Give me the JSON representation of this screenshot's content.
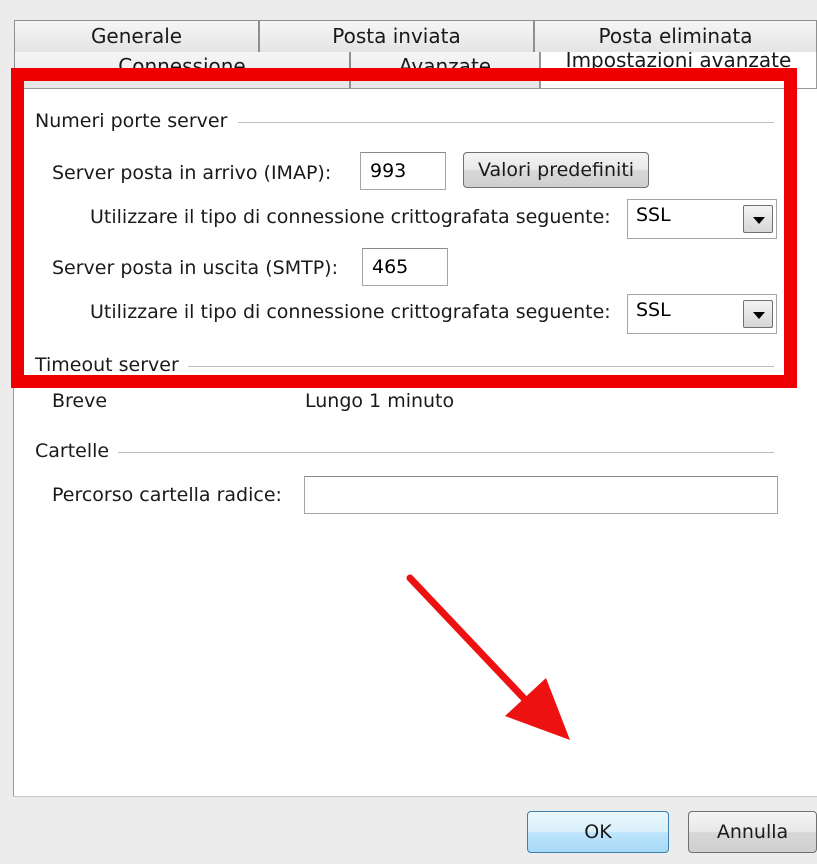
{
  "tabs_row1": [
    "Generale",
    "Posta inviata",
    "Posta eliminata"
  ],
  "tabs_row2": [
    "Connessione",
    "Avanzate",
    "Impostazioni avanzate"
  ],
  "ports": {
    "section_title": "Numeri porte server",
    "incoming_label": "Server posta in arrivo (IMAP):",
    "incoming_value": "993",
    "defaults_button": "Valori predefiniti",
    "encryption_label": "Utilizzare il tipo di connessione crittografata seguente:",
    "incoming_encryption": "SSL",
    "outgoing_label": "Server posta in uscita (SMTP):",
    "outgoing_value": "465",
    "outgoing_encryption": "SSL"
  },
  "timeout": {
    "section_title": "Timeout server",
    "short_label": "Breve",
    "long_label": "Lungo 1 minuto"
  },
  "folders": {
    "section_title": "Cartelle",
    "root_path_label": "Percorso cartella radice:",
    "root_path_value": ""
  },
  "footer": {
    "ok_label": "OK",
    "cancel_label": "Annulla"
  },
  "colors": {
    "highlight": "#ee0000"
  }
}
